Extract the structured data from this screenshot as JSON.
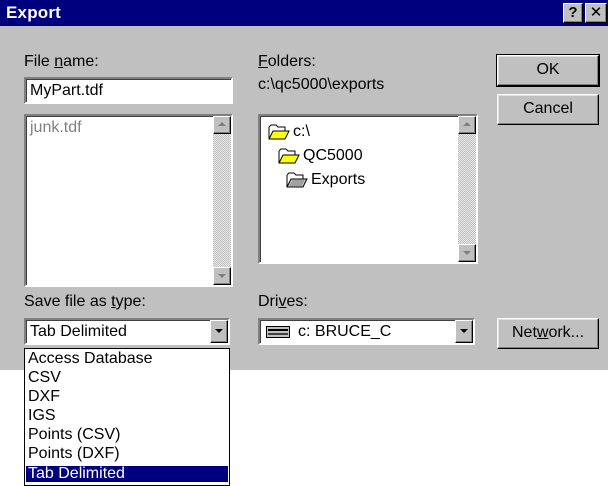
{
  "window": {
    "title": "Export",
    "help_button": "?",
    "close_button": "✕"
  },
  "file_name": {
    "label_prefix": "File ",
    "label_accel": "n",
    "label_suffix": "ame:",
    "value": "MyPart.tdf",
    "list_items": [
      "junk.tdf"
    ]
  },
  "folders": {
    "label_accel": "F",
    "label_suffix": "olders:",
    "current_path": "c:\\qc5000\\exports",
    "tree": [
      {
        "label": "c:\\",
        "icon": "open-folder-icon"
      },
      {
        "label": "QC5000",
        "icon": "open-folder-icon"
      },
      {
        "label": "Exports",
        "icon": "open-folder-selected-icon"
      }
    ]
  },
  "buttons": {
    "ok": "OK",
    "cancel": "Cancel",
    "network_prefix": "Net",
    "network_accel": "w",
    "network_suffix": "ork..."
  },
  "save_type": {
    "label_prefix": "Save file as ",
    "label_accel": "t",
    "label_suffix": "ype:",
    "selected": "Tab Delimited",
    "options": [
      "Access Database",
      "CSV",
      "DXF",
      "IGS",
      "Points (CSV)",
      "Points (DXF)",
      "Tab Delimited"
    ],
    "highlighted_index": 6
  },
  "drives": {
    "label_prefix": "Dri",
    "label_accel": "v",
    "label_suffix": "es:",
    "selected": "c: BRUCE_C",
    "icon": "hard-drive-icon"
  },
  "colors": {
    "titlebar": "#00007f",
    "face": "#c0c0c0",
    "selection": "#00007f"
  }
}
